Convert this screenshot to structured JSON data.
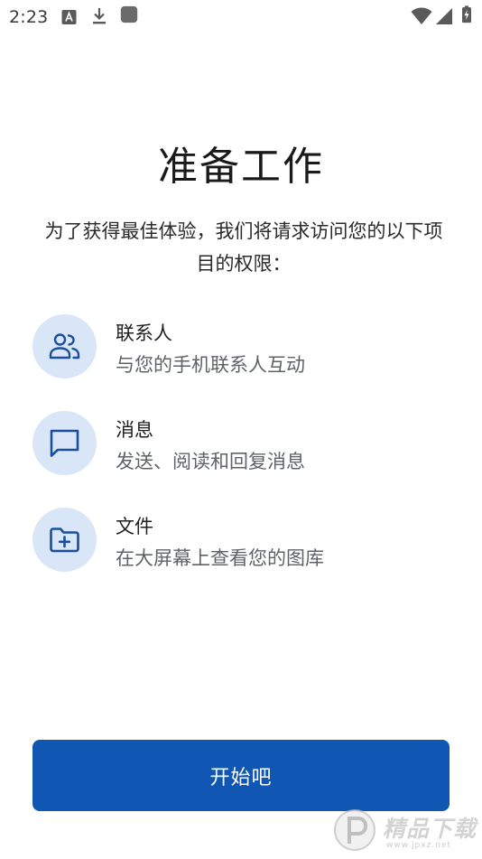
{
  "status_bar": {
    "time": "2:23",
    "left_icons": [
      "font-a-icon",
      "download-icon",
      "app-square-icon"
    ],
    "right_icons": [
      "wifi-icon",
      "cellular-signal-icon",
      "battery-charging-icon"
    ]
  },
  "main": {
    "title": "准备工作",
    "intro": "为了获得最佳体验，我们将请求访问您的以下项目的权限：",
    "permissions": [
      {
        "icon": "contacts-icon",
        "title": "联系人",
        "description": "与您的手机联系人互动"
      },
      {
        "icon": "message-icon",
        "title": "消息",
        "description": "发送、阅读和回复消息"
      },
      {
        "icon": "folder-add-icon",
        "title": "文件",
        "description": "在大屏幕上查看您的图库"
      }
    ]
  },
  "footer": {
    "start_label": "开始吧"
  },
  "watermark": {
    "text": "精品下载",
    "subtext": "www.jpxz.net"
  },
  "colors": {
    "accent": "#0f57b3",
    "icon_circle": "#d9e6f8",
    "icon_stroke": "#1b4f9c",
    "secondary_text": "#5f6368"
  }
}
